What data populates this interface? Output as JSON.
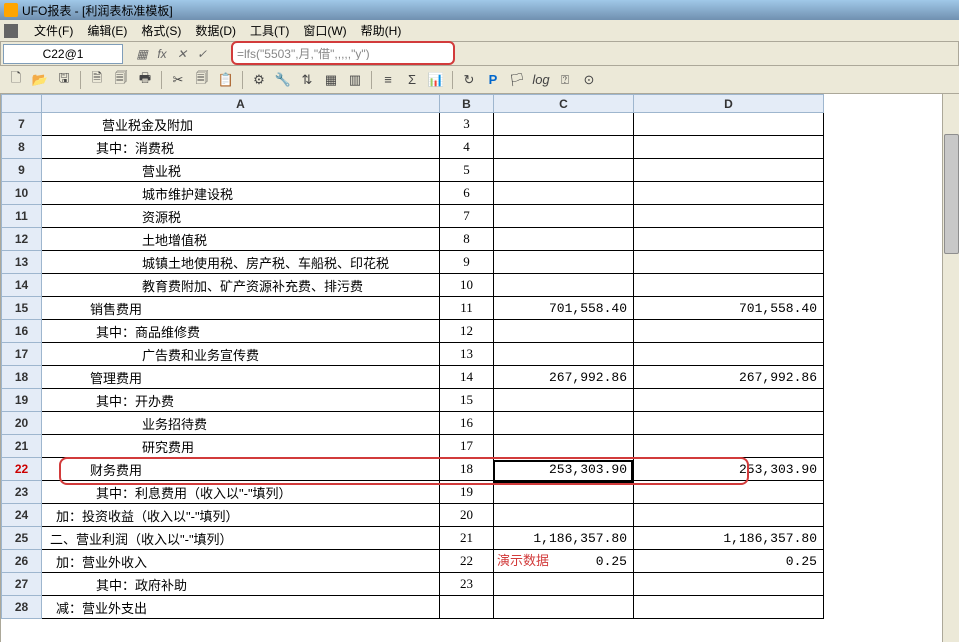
{
  "title": "UFO报表 - [利润表标准模板]",
  "menu": [
    "文件(F)",
    "编辑(E)",
    "格式(S)",
    "数据(D)",
    "工具(T)",
    "窗口(W)",
    "帮助(H)"
  ],
  "cellref": "C22@1",
  "formula": "=lfs(\"5503\",月,\"借\",,,,,\"y\")",
  "cols": [
    "",
    "A",
    "B",
    "C",
    "D"
  ],
  "rows": [
    {
      "n": "7",
      "a": "营业税金及附加",
      "b": "3",
      "c": "",
      "d": ""
    },
    {
      "n": "8",
      "a": "其中：消费税",
      "b": "4",
      "c": "",
      "d": ""
    },
    {
      "n": "9",
      "a": "营业税",
      "b": "5",
      "c": "",
      "d": ""
    },
    {
      "n": "10",
      "a": "城市维护建设税",
      "b": "6",
      "c": "",
      "d": ""
    },
    {
      "n": "11",
      "a": "资源税",
      "b": "7",
      "c": "",
      "d": ""
    },
    {
      "n": "12",
      "a": "土地增值税",
      "b": "8",
      "c": "",
      "d": ""
    },
    {
      "n": "13",
      "a": "城镇土地使用税、房产税、车船税、印花税",
      "b": "9",
      "c": "",
      "d": ""
    },
    {
      "n": "14",
      "a": "教育费附加、矿产资源补充费、排污费",
      "b": "10",
      "c": "",
      "d": ""
    },
    {
      "n": "15",
      "a": "销售费用",
      "b": "11",
      "c": "701,558.40",
      "d": "701,558.40"
    },
    {
      "n": "16",
      "a": "其中：商品维修费",
      "b": "12",
      "c": "",
      "d": ""
    },
    {
      "n": "17",
      "a": "广告费和业务宣传费",
      "b": "13",
      "c": "",
      "d": ""
    },
    {
      "n": "18",
      "a": "管理费用",
      "b": "14",
      "c": "267,992.86",
      "d": "267,992.86"
    },
    {
      "n": "19",
      "a": "其中：开办费",
      "b": "15",
      "c": "",
      "d": ""
    },
    {
      "n": "20",
      "a": "业务招待费",
      "b": "16",
      "c": "",
      "d": ""
    },
    {
      "n": "21",
      "a": "研究费用",
      "b": "17",
      "c": "",
      "d": ""
    },
    {
      "n": "22",
      "a": "财务费用",
      "b": "18",
      "c": "253,303.90",
      "d": "253,303.90"
    },
    {
      "n": "23",
      "a": "其中：利息费用（收入以\"-\"填列）",
      "b": "19",
      "c": "",
      "d": ""
    },
    {
      "n": "24",
      "a": "加：投资收益（收入以\"-\"填列）",
      "b": "20",
      "c": "",
      "d": ""
    },
    {
      "n": "25",
      "a": "二、营业利润（收入以\"-\"填列）",
      "b": "21",
      "c": "1,186,357.80",
      "d": "1,186,357.80"
    },
    {
      "n": "26",
      "a": "加：营业外收入",
      "b": "22",
      "c": "0.25",
      "d": "0.25"
    },
    {
      "n": "27",
      "a": "其中：政府补助",
      "b": "23",
      "c": "",
      "d": ""
    },
    {
      "n": "28",
      "a": "减：营业外支出",
      "b": "",
      "c": "",
      "d": ""
    }
  ],
  "indent": {
    "7": 60,
    "8": 54,
    "9": 100,
    "10": 100,
    "11": 100,
    "12": 100,
    "13": 100,
    "14": 100,
    "15": 48,
    "16": 54,
    "17": 100,
    "18": 48,
    "19": 54,
    "20": 100,
    "21": 100,
    "22": 48,
    "23": 54,
    "24": 14,
    "25": 8,
    "26": 14,
    "27": 54,
    "28": 14
  },
  "demoText": "演示数据"
}
